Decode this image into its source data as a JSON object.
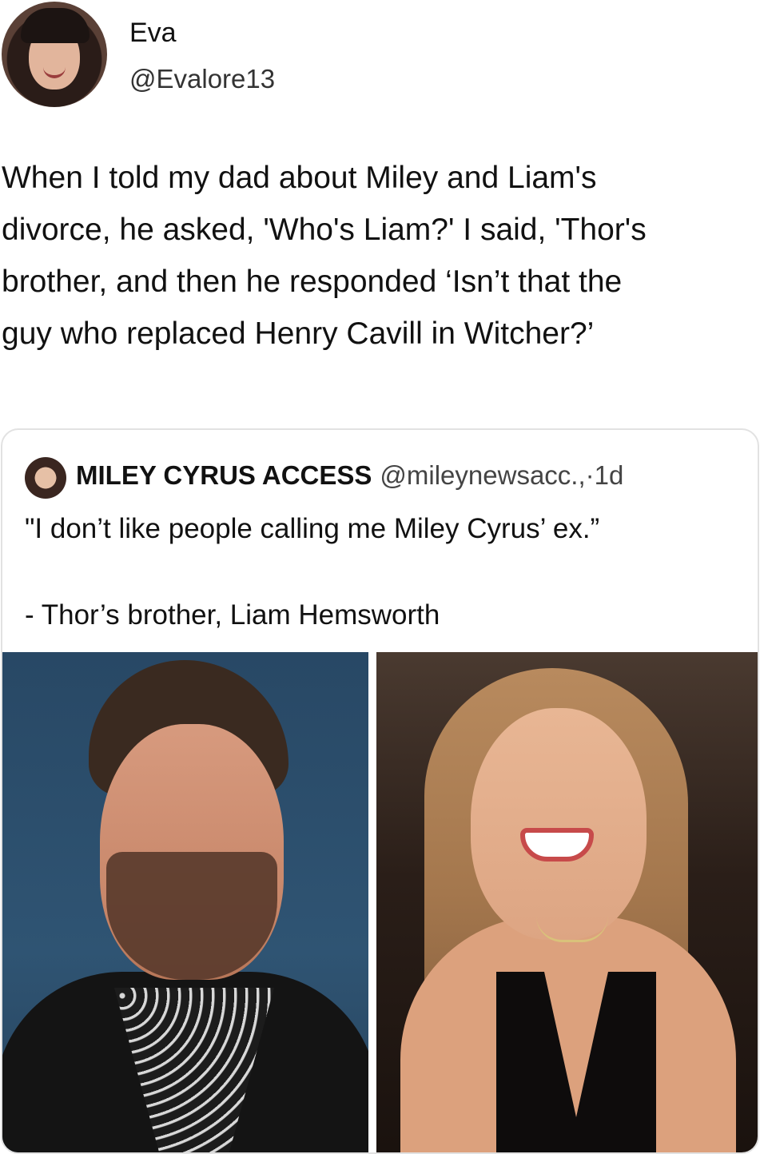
{
  "author": {
    "display_name": "Eva",
    "handle": "@Evalore13",
    "avatar_icon": "user-avatar-photo"
  },
  "tweet": {
    "lines": [
      "When I told my dad about Miley and Liam's",
      "divorce, he asked, 'Who's Liam?' I said, 'Thor's",
      "brother, and then he responded ‘Isn’t that the",
      "guy who replaced Henry Cavill in Witcher?’"
    ]
  },
  "quote": {
    "account_name": "MILEY CYRUS ACCESS",
    "handle": "@mileynewsacc.,",
    "time": "·1d",
    "line1": "\"I don’t like people calling me Miley Cyrus’ ex.”",
    "line2": "- Thor’s brother, Liam Hemsworth",
    "avatar_icon": "account-avatar-photo",
    "images": [
      {
        "name": "liam-hemsworth-photo"
      },
      {
        "name": "miley-cyrus-photo"
      }
    ]
  },
  "colors": {
    "background": "#ffffff",
    "text": "#111111",
    "secondary_text": "#444444",
    "card_border": "#e2e2e2"
  }
}
